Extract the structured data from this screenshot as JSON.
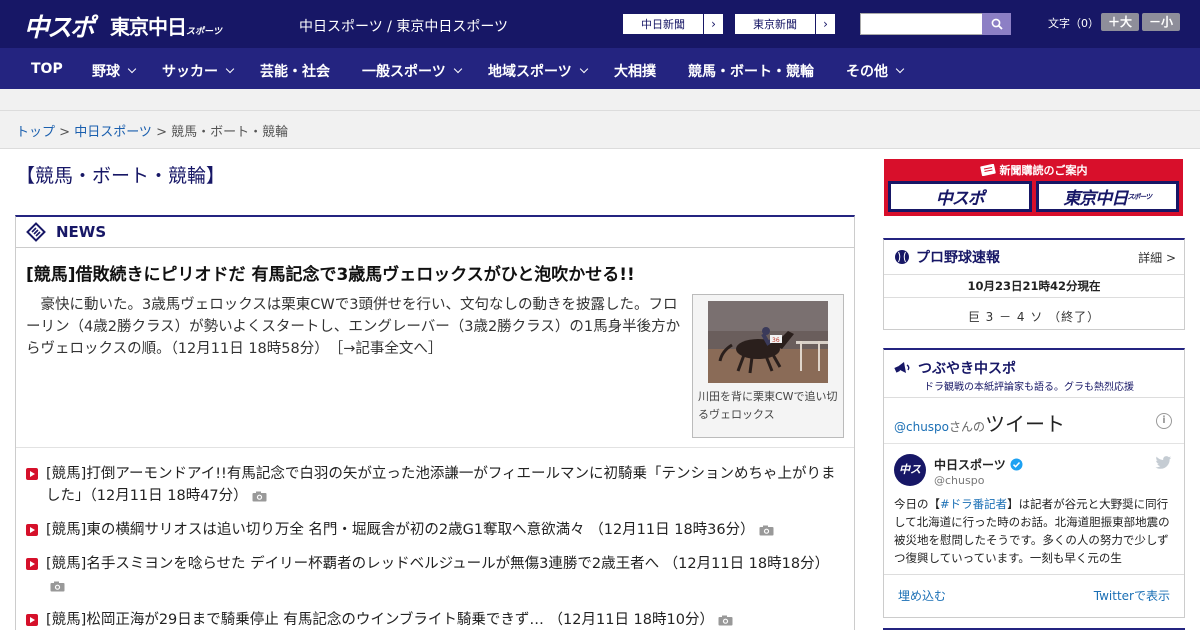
{
  "header": {
    "logo_chuspo": "中スポ",
    "logo_tokyo": "東京中日",
    "logo_tokyo_sub": "スポーツ",
    "site_name": "中日スポーツ / 東京中日スポーツ",
    "paper_buttons": [
      {
        "label": "中日新聞",
        "arrow": "›"
      },
      {
        "label": "東京新聞",
        "arrow": "›"
      }
    ],
    "search_placeholder": "",
    "font_size_label": "文字（0）",
    "font_plus": "＋大",
    "font_minus": "－小"
  },
  "nav": {
    "items": [
      {
        "label": "TOP",
        "dropdown": false
      },
      {
        "label": "野球",
        "dropdown": true
      },
      {
        "label": "サッカー",
        "dropdown": true
      },
      {
        "label": "芸能・社会",
        "dropdown": false
      },
      {
        "label": "一般スポーツ",
        "dropdown": true
      },
      {
        "label": "地域スポーツ",
        "dropdown": true
      },
      {
        "label": "大相撲",
        "dropdown": false
      },
      {
        "label": "競馬・ボート・競輪",
        "dropdown": false
      },
      {
        "label": "その他",
        "dropdown": true
      }
    ]
  },
  "breadcrumb": {
    "top": "トップ",
    "sep1": " > ",
    "parent": "中日スポーツ",
    "sep2": " > ",
    "current": "競馬・ボート・競輪"
  },
  "page_title": "【競馬・ボート・競輪】",
  "news": {
    "section_label": "NEWS",
    "lead": {
      "title": "[競馬]借敗続きにピリオドだ 有馬記念で3歳馬ヴェロックスがひと泡吹かせる!!",
      "body": "豪快に動いた。3歳馬ヴェロックスは栗東CWで3頭併せを行い、文句なしの動きを披露した。フローリン（4歳2勝クラス）が勢いよくスタートし、エングレーバー（3歳2勝クラス）の1馬身半後方からヴェロックスの順。（12月11日 18時58分）",
      "more": "［→記事全文へ］",
      "photo_caption": "川田を背に栗東CWで追い切るヴェロックス"
    },
    "headlines": [
      "[競馬]打倒アーモンドアイ!!有馬記念で白羽の矢が立った池添謙一がフィエールマンに初騎乗「テンションめちゃ上がりました」（12月11日 18時47分）",
      "[競馬]東の横綱サリオスは追い切り万全 名門・堀厩舎が初の2歳G1奪取へ意欲満々 （12月11日 18時36分）",
      "[競馬]名手スミヨンを唸らせた デイリー杯覇者のレッドベルジュールが無傷3連勝で2歳王者へ （12月11日 18時18分）",
      "[競馬]松岡正海が29日まで騎乗停止 有馬記念のウインブライト騎乗できず… （12月11日 18時10分）"
    ]
  },
  "sidebar": {
    "subscription": {
      "heading": "新聞購読のご案内",
      "logo1": "中スポ",
      "logo2": "東京中日",
      "logo2_sub": "スポーツ"
    },
    "scores": {
      "title": "プロ野球速報",
      "more": "詳細 >",
      "timestamp": "10月23日21時42分現在",
      "game": "巨 3 － 4 ソ （終了）"
    },
    "tweets": {
      "title": "つぶやき中スポ",
      "subtitle": "ドラ観戦の本紙評論家も語る。グラも熱烈応援",
      "handle": "@chuspo",
      "handle_suffix": "さんの",
      "header_big": "ツイート",
      "info": "i",
      "account_name": "中日スポーツ",
      "account_id": "@chuspo",
      "avatar_text": "中スポ",
      "text_prefix": "今日の【",
      "text_tag": "#ドラ番記者",
      "text_rest": "】は記者が谷元と大野奨に同行して北海道に行った時のお話。北海道胆振東部地震の被災地を慰問したそうです。多くの人の努力で少しずつ復興していっています。一刻も早く元の生",
      "embed": "埋め込む",
      "view": "Twitterで表示"
    }
  },
  "colors": {
    "header_bg": "#171766",
    "nav_bg": "#242480",
    "accent_red": "#d80f2b",
    "link_blue": "#1a5fae"
  }
}
